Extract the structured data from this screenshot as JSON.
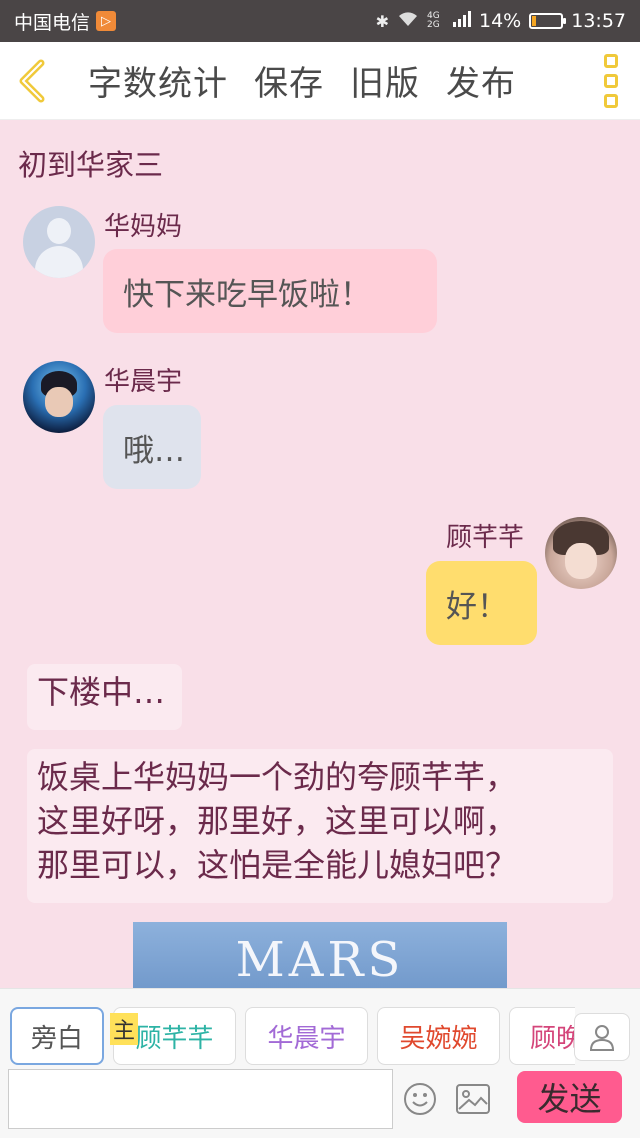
{
  "status_bar": {
    "carrier": "中国电信",
    "network": "4G 2G",
    "battery": "14%",
    "battery_level": 0.14,
    "time": "13:57"
  },
  "toolbar": {
    "items": [
      "字数统计",
      "保存",
      "旧版",
      "发布"
    ]
  },
  "chapter_title": "初到华家三",
  "messages": [
    {
      "speaker": "华妈妈",
      "text": "快下来吃早饭啦！",
      "side": "left",
      "bubble_color": "#ffcfd9"
    },
    {
      "speaker": "华晨宇",
      "text": "哦…",
      "side": "left",
      "bubble_color": "#dfe3ed"
    },
    {
      "speaker": "顾芊芊",
      "text": "好！",
      "side": "right",
      "bubble_color": "#ffdd6e"
    }
  ],
  "narrations": [
    {
      "lines": [
        "下楼中…"
      ]
    },
    {
      "lines": [
        "饭桌上华妈妈一个劲的夸顾芊芊，",
        "这里好呀，那里好，这里可以啊，",
        "那里可以，这怕是全能儿媳妇吧？"
      ]
    }
  ],
  "image_caption": "MARS",
  "roles": [
    {
      "label": "旁白",
      "color": "#555555",
      "selected": true
    },
    {
      "label": "顾芊芊",
      "color": "#2db3a5",
      "selected": false
    },
    {
      "label": "华晨宇",
      "color": "#a26ad6",
      "selected": false
    },
    {
      "label": "吴婉婉",
      "color": "#e0492e",
      "selected": false
    },
    {
      "label": "顾晚",
      "color": "#d4457a",
      "selected": false
    }
  ],
  "main_tag": "主",
  "input": {
    "value": "",
    "placeholder": ""
  },
  "send_label": "发送",
  "icons": [
    "back-icon",
    "more-icon",
    "user-icon",
    "emoji-icon",
    "image-icon"
  ],
  "colors": {
    "accent": "#ff5b8f",
    "text": "#6b2a4b",
    "background": "#f9dfe8"
  }
}
